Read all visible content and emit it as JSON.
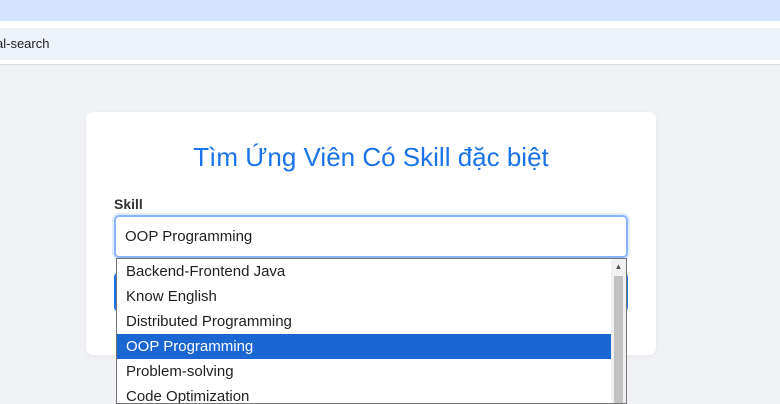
{
  "browser": {
    "url": "al-search"
  },
  "card": {
    "title": "Tìm Ứng Viên Có Skill đặc biệt",
    "skill_label": "Skill",
    "selected_skill": "OOP Programming"
  },
  "dropdown": {
    "options": [
      "Backend-Frontend Java",
      "Know English",
      "Distributed Programming",
      "OOP Programming",
      "Problem-solving",
      "Code Optimization"
    ],
    "selected_index": 3,
    "scroll_up_icon": "triangle-up-icon"
  },
  "colors": {
    "accent": "#1a73e8",
    "selected_option": "#1a66d2",
    "focus_border": "#8ab4f8"
  }
}
